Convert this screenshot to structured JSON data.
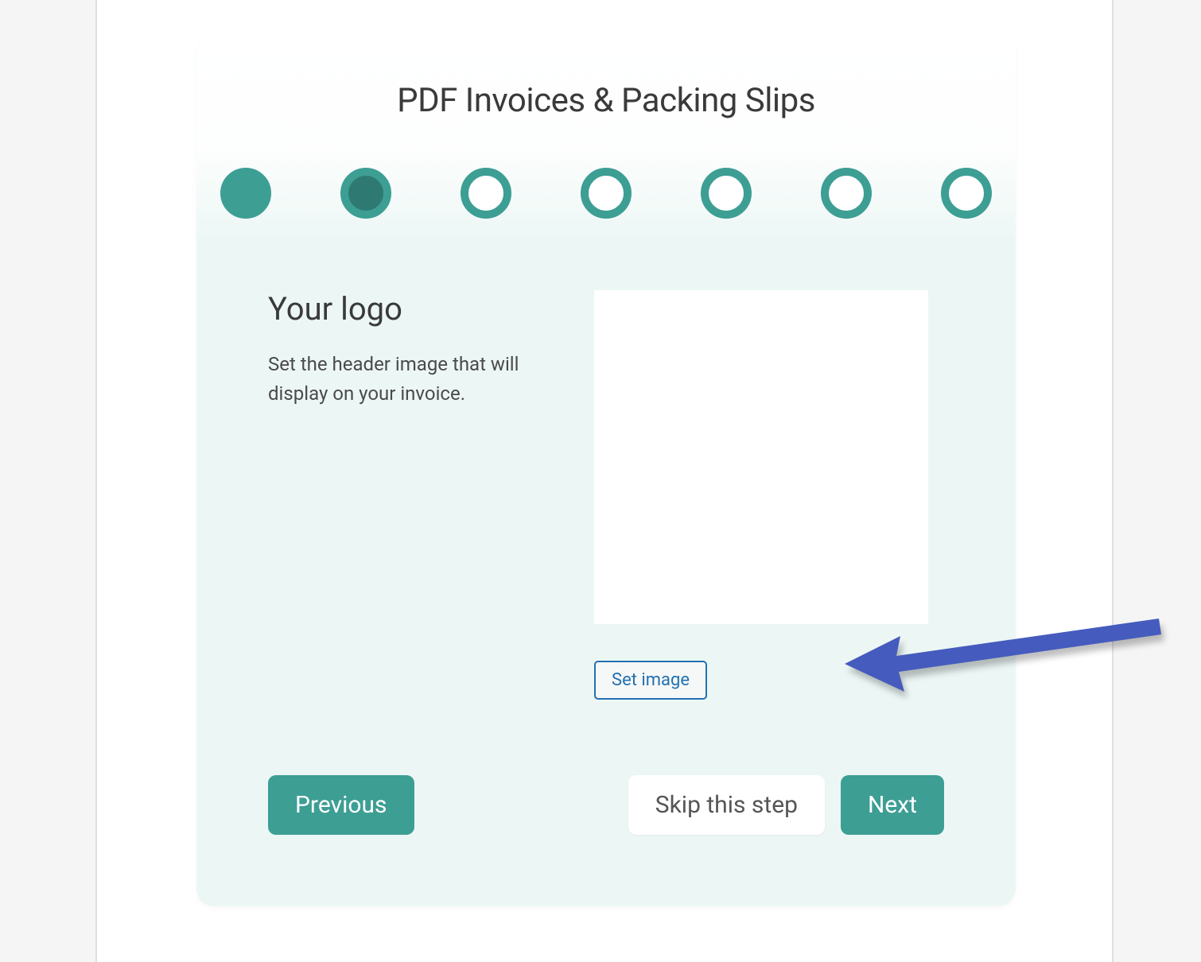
{
  "wizard": {
    "title": "PDF Invoices & Packing Slips",
    "steps": [
      {
        "state": "completed"
      },
      {
        "state": "current"
      },
      {
        "state": "upcoming"
      },
      {
        "state": "upcoming"
      },
      {
        "state": "upcoming"
      },
      {
        "state": "upcoming"
      },
      {
        "state": "upcoming"
      }
    ],
    "section": {
      "title": "Your logo",
      "description": "Set the header image that will display on your invoice."
    },
    "set_image_label": "Set image",
    "buttons": {
      "previous": "Previous",
      "skip": "Skip this step",
      "next": "Next"
    }
  },
  "colors": {
    "teal": "#3d9e94",
    "teal_dark": "#2e7a72",
    "panel_bg": "#ecf7f5",
    "link_blue": "#2271b1",
    "arrow": "#455bbd"
  }
}
